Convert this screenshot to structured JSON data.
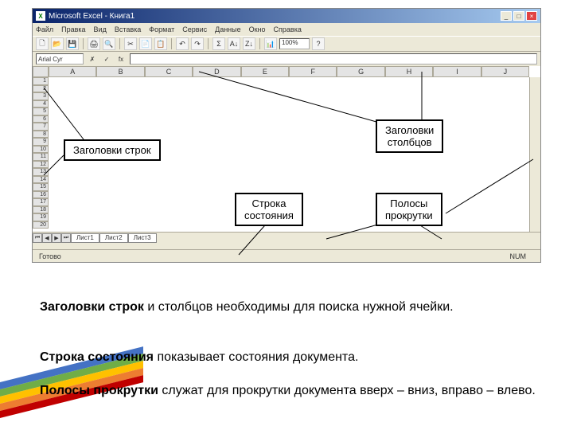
{
  "window": {
    "app": "Microsoft Excel",
    "doc": "Книга1",
    "titlefull": "Microsoft Excel - Книга1"
  },
  "menu": [
    "Файл",
    "Правка",
    "Вид",
    "Вставка",
    "Формат",
    "Сервис",
    "Данные",
    "Окно",
    "Справка"
  ],
  "toolbar": {
    "zoom": "100%"
  },
  "formula": {
    "namebox": "Arial Cyr"
  },
  "columns": [
    "A",
    "B",
    "C",
    "D",
    "E",
    "F",
    "G",
    "H",
    "I",
    "J"
  ],
  "rows": [
    "1",
    "2",
    "3",
    "4",
    "5",
    "6",
    "7",
    "8",
    "9",
    "10",
    "11",
    "12",
    "13",
    "14",
    "15",
    "16",
    "17",
    "18",
    "19",
    "20"
  ],
  "sheets": {
    "nav": [
      "⏮",
      "◀",
      "▶",
      "⏭"
    ],
    "tabs": [
      "Лист1",
      "Лист2",
      "Лист3"
    ]
  },
  "status": {
    "ready": "Готово",
    "num": "NUM"
  },
  "callouts": {
    "rowHeaders": "Заголовки строк",
    "colHeaders": "Заголовки\nстолбцов",
    "statusbar": "Строка\nсостояния",
    "scrollbars": "Полосы\nпрокрутки"
  },
  "text": {
    "p1_bold": "Заголовки строк",
    "p1_rest": " и столбцов необходимы для поиска нужной ячейки.",
    "p2_bold": "Строка состояния",
    "p2_rest": " показывает состояния документа.",
    "p3_bold": "Полосы прокрутки",
    "p3_rest": " служат для прокрутки документа вверх – вниз, вправо – влево."
  }
}
